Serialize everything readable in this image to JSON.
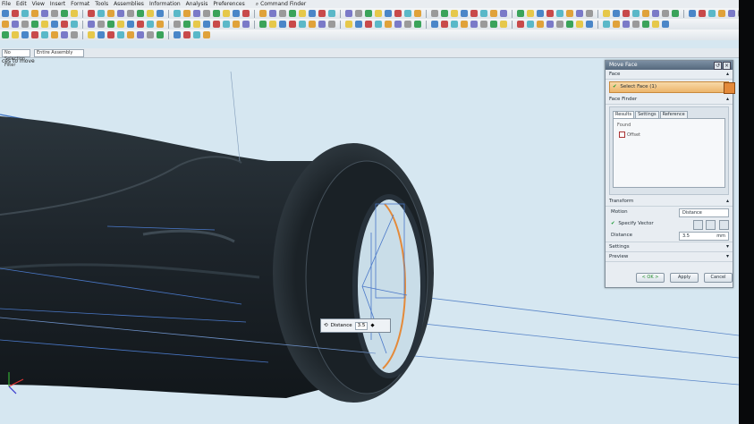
{
  "menu": [
    "File",
    "Edit",
    "View",
    "Insert",
    "Format",
    "Tools",
    "Assemblies",
    "Information",
    "Analysis",
    "Preferences"
  ],
  "command_finder": "Command Finder",
  "filter": {
    "type": "No Selection Filter",
    "scope": "Entire Assembly"
  },
  "status_text": "ces to move",
  "dialog": {
    "title": "Move Face",
    "face_section": "Face",
    "select_face": "Select Face (1)",
    "face_finder": "Face Finder",
    "tabs": [
      "Results",
      "Settings",
      "Reference"
    ],
    "found_label": "Found",
    "found_item": "Offset",
    "transform_section": "Transform",
    "motion_label": "Motion",
    "motion_value": "Distance",
    "specify_vector": "Specify Vector",
    "distance_label": "Distance",
    "distance_value": "3.5",
    "distance_unit": "mm",
    "settings_section": "Settings",
    "preview_section": "Preview",
    "ok": "< OK >",
    "apply": "Apply",
    "cancel": "Cancel"
  },
  "onscreen_label": {
    "name": "Distance",
    "value": "3.5"
  },
  "colors": {
    "viewport": "#d6e7f1",
    "model_dark": "#1f272d",
    "edge_blue": "#4a78c8",
    "accent_orange": "#e48a3a"
  }
}
